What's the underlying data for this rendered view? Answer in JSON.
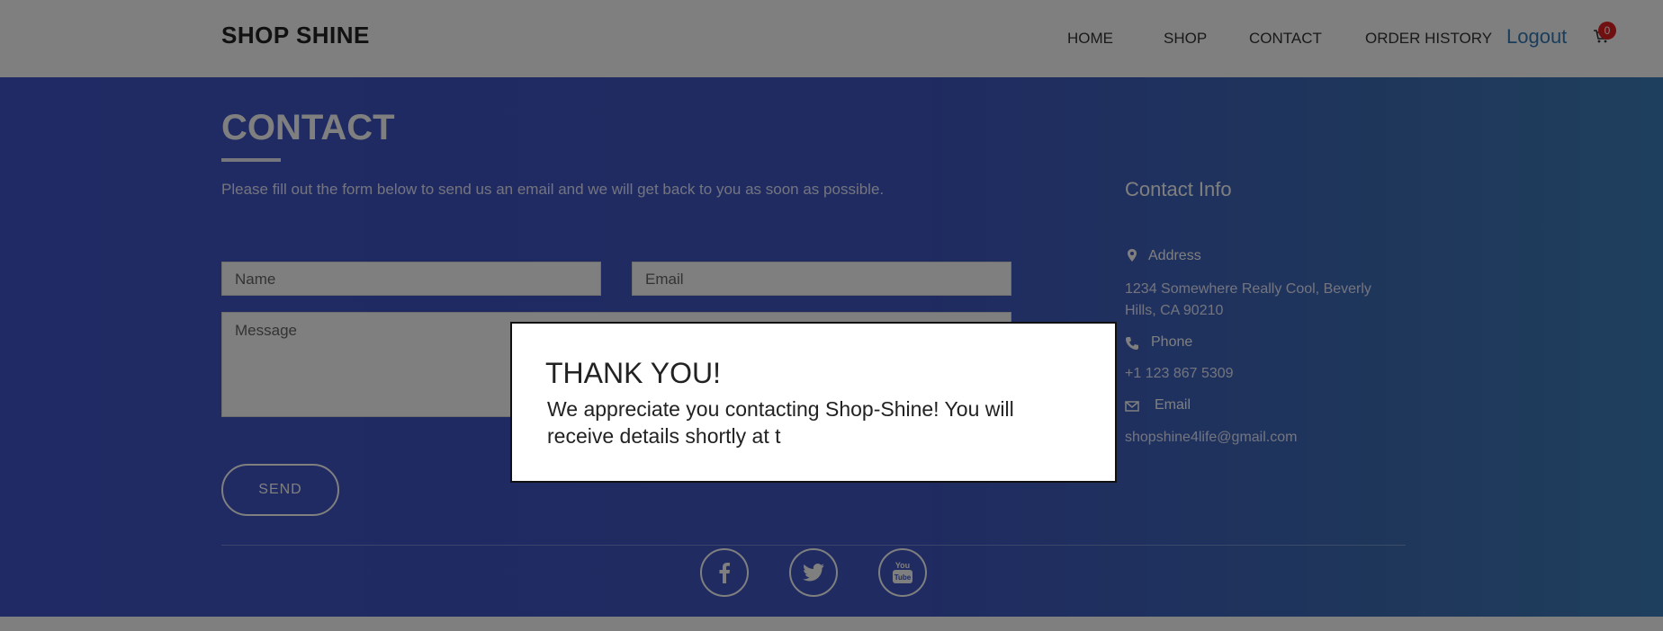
{
  "navbar": {
    "brand": "SHOP SHINE",
    "links": [
      "HOME",
      "SHOP",
      "CONTACT",
      "ORDER HISTORY"
    ],
    "logout": "Logout",
    "cart_count": "0"
  },
  "contact": {
    "title": "CONTACT",
    "intro": "Please fill out the form below to send us an email and we will get back to you as soon as possible.",
    "name_placeholder": "Name",
    "email_placeholder": "Email",
    "message_placeholder": "Message",
    "send_label": "SEND"
  },
  "contact_info": {
    "title": "Contact Info",
    "address_label": "Address",
    "address_value": "1234 Somewhere Really Cool, Beverly Hills, CA 90210",
    "phone_label": "Phone",
    "phone_value": "+1 123 867 5309",
    "email_label": "Email",
    "email_value": "shopshine4life@gmail.com"
  },
  "social": [
    "facebook-icon",
    "twitter-icon",
    "youtube-icon"
  ],
  "modal": {
    "title": "THANK YOU!",
    "body": "We appreciate you contacting Shop-Shine! You will receive details shortly at t"
  },
  "colors": {
    "section_gradient_start": "#4155c8",
    "section_gradient_end": "#3e7fbd",
    "logout_link": "#337ab7",
    "cart_badge": "#e02020"
  }
}
